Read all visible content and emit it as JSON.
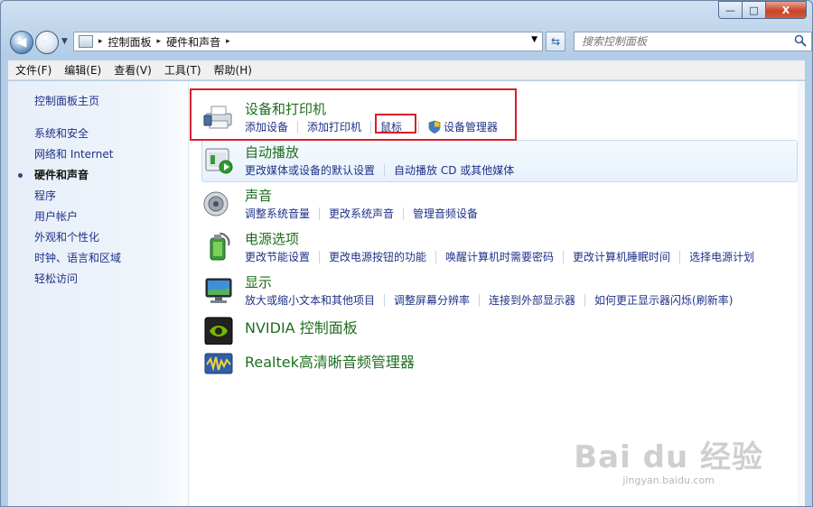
{
  "window": {
    "caption": {
      "minimize": "—",
      "maximize": "□",
      "close": "X"
    }
  },
  "nav": {
    "back_glyph": "◀",
    "forward_glyph": "▶",
    "breadcrumbs": [
      "控制面板",
      "硬件和声音"
    ],
    "crumb_separator": "▸",
    "dropdown_glyph": "▼",
    "refresh_glyph": "⇆",
    "search_placeholder": "搜索控制面板"
  },
  "menu": [
    "文件(F)",
    "编辑(E)",
    "查看(V)",
    "工具(T)",
    "帮助(H)"
  ],
  "sidebar": {
    "home": "控制面板主页",
    "items": [
      {
        "label": "系统和安全",
        "active": false
      },
      {
        "label": "网络和 Internet",
        "active": false
      },
      {
        "label": "硬件和声音",
        "active": true
      },
      {
        "label": "程序",
        "active": false
      },
      {
        "label": "用户帐户",
        "active": false
      },
      {
        "label": "外观和个性化",
        "active": false
      },
      {
        "label": "时钟、语言和区域",
        "active": false
      },
      {
        "label": "轻松访问",
        "active": false
      }
    ]
  },
  "categories": [
    {
      "title": "设备和打印机",
      "icon": "printer-icon",
      "links": [
        "添加设备",
        "添加打印机",
        "鼠标",
        "设备管理器"
      ]
    },
    {
      "title": "自动播放",
      "icon": "autoplay-icon",
      "links": [
        "更改媒体或设备的默认设置",
        "自动播放 CD 或其他媒体"
      ]
    },
    {
      "title": "声音",
      "icon": "speaker-icon",
      "links": [
        "调整系统音量",
        "更改系统声音",
        "管理音频设备"
      ]
    },
    {
      "title": "电源选项",
      "icon": "battery-icon",
      "links": [
        "更改节能设置",
        "更改电源按钮的功能",
        "唤醒计算机时需要密码",
        "更改计算机睡眠时间",
        "选择电源计划"
      ]
    },
    {
      "title": "显示",
      "icon": "monitor-icon",
      "links": [
        "放大或缩小文本和其他项目",
        "调整屏幕分辨率",
        "连接到外部显示器",
        "如何更正显示器闪烁(刷新率)"
      ]
    },
    {
      "title": "NVIDIA 控制面板",
      "icon": "nvidia-icon",
      "links": []
    },
    {
      "title": "Realtek高清晰音频管理器",
      "icon": "realtek-icon",
      "links": []
    }
  ],
  "watermark": {
    "logo": "Bai du 经验",
    "url": "jingyan.baidu.com"
  },
  "colors": {
    "link": "#1e3287",
    "category_title": "#1e6e1e",
    "highlight": "#d6202a"
  }
}
